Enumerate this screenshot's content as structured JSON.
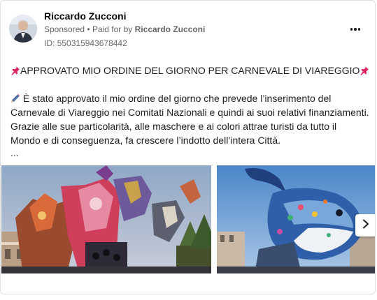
{
  "post": {
    "author": "Riccardo Zucconi",
    "sponsored": "Sponsored",
    "separator": "•",
    "paid_for_prefix": "Paid for by",
    "paid_for_name": "Riccardo Zucconi",
    "ad_id": "ID: 550315943678442",
    "headline": "APPROVATO MIO ORDINE DEL GIORNO PER CARNEVALE DI VIAREGGIO",
    "body_lines": [
      "È stato approvato il mio ordine del giorno che prevede l’inserimento del",
      "Carnevale di Viareggio nei Comitati Nazionali e quindi ai suoi relativi finanziamenti.",
      "Grazie alle sue particolarità, alle maschere e ai colori attrae turisti da tutto il",
      "Mondo e di conseguenza, fa crescere l’indotto dell’intera Città."
    ],
    "see_more": "..."
  },
  "icons": {
    "pin": "pushpin-icon",
    "pen": "pen-icon",
    "more": "more-options-icon",
    "next": "chevron-right-icon"
  },
  "colors": {
    "text": "#1c1e21",
    "secondary": "#65676b",
    "pin_red": "#e0245e",
    "border": "#dddfe2"
  }
}
